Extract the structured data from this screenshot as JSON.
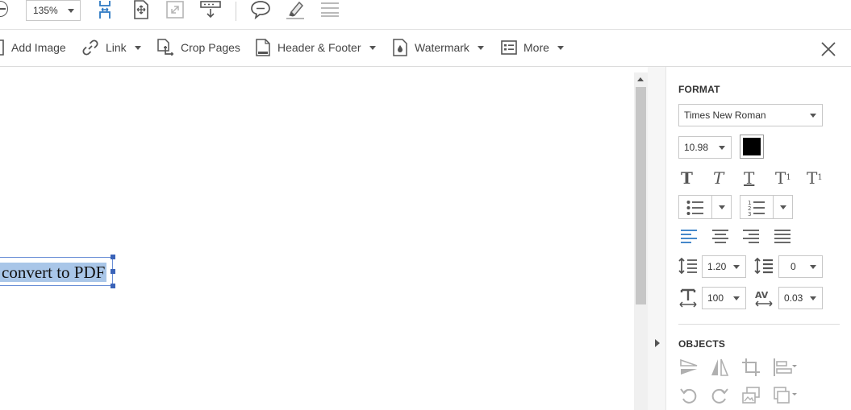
{
  "top_toolbar": {
    "zoom_value": "135%",
    "icons": [
      "zoom-out-icon",
      "fit-page-icon",
      "fit-width-icon",
      "full-screen-icon",
      "scroll-mode-icon",
      "comment-icon",
      "highlight-icon",
      "strikethrough-icon"
    ]
  },
  "edit_toolbar": {
    "add_image": "Add Image",
    "link": "Link",
    "crop_pages": "Crop Pages",
    "header_footer": "Header & Footer",
    "watermark": "Watermark",
    "more": "More"
  },
  "document": {
    "selected_text": "convert to PDF"
  },
  "format_panel": {
    "format_title": "FORMAT",
    "font_family": "Times New Roman",
    "font_size": "10.98",
    "font_color": "#000000",
    "line_spacing": "1.20",
    "paragraph_spacing": "0",
    "horizontal_scale": "100",
    "char_spacing": "0.03",
    "objects_title": "OBJECTS"
  },
  "colors": {
    "accent_blue": "#2b78c2",
    "selection": "#a9c6e8",
    "icon_gray": "#555555",
    "disabled_gray": "#b0b0b0"
  }
}
